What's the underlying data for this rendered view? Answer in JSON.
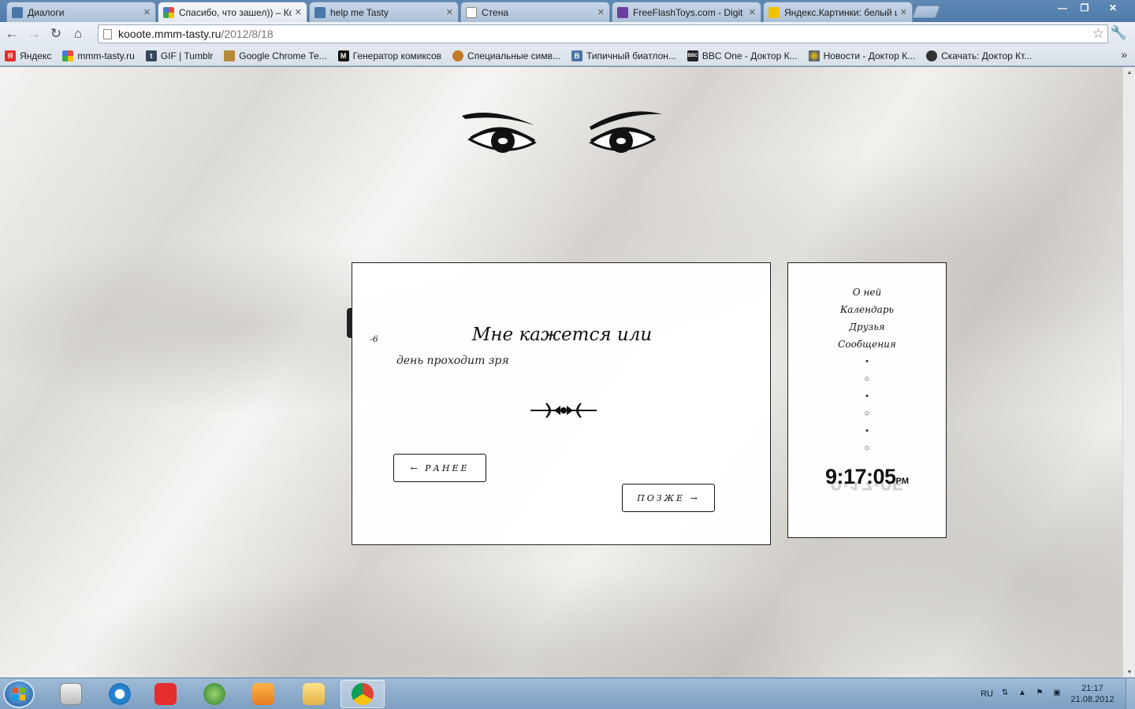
{
  "browser": {
    "tabs": [
      {
        "title": "Диалоги",
        "icon": "vk-icon",
        "color": "#4a76a8"
      },
      {
        "title": "Спасибо, что зашел)) – Кооо",
        "icon": "mmm-tasty-icon",
        "color": "#e84b3c"
      },
      {
        "title": "help me Tasty",
        "icon": "vk-icon",
        "color": "#4a76a8"
      },
      {
        "title": "Стена",
        "icon": "page-icon",
        "color": "#ffffff"
      },
      {
        "title": "FreeFlashToys.com - Digit",
        "icon": "fft-icon",
        "color": "#6b3fa0"
      },
      {
        "title": "Яндекс.Картинки: белый ш",
        "icon": "yandex-images-icon",
        "color": "#f2c200"
      }
    ],
    "url_host": "kooote.mmm-tasty.ru",
    "url_path": "/2012/8/18",
    "bookmarks": [
      {
        "label": "Яндекс",
        "icon": "yandex-icon",
        "color": "#e62d2d"
      },
      {
        "label": "mmm-tasty.ru",
        "icon": "mmm-tasty-icon",
        "color": "#e84b3c"
      },
      {
        "label": "GIF | Tumblr",
        "icon": "tumblr-icon",
        "color": "#35465c"
      },
      {
        "label": "Google Chrome Те...",
        "icon": "chrome-theme-icon",
        "color": "#b58a3a"
      },
      {
        "label": "Генератор комиксов",
        "icon": "comics-icon",
        "color": "#111111"
      },
      {
        "label": "Специальные симв...",
        "icon": "symbols-icon",
        "color": "#c47a28"
      },
      {
        "label": "Типичный биатлон...",
        "icon": "vk-icon",
        "color": "#4a76a8"
      },
      {
        "label": "BBC One - Доктор К...",
        "icon": "bbc-icon",
        "color": "#222222"
      },
      {
        "label": "Новости - Доктор К...",
        "icon": "doctor-icon",
        "color": "#1f3d8a"
      },
      {
        "label": "Скачать: Доктор Кт...",
        "icon": "download-icon",
        "color": "#333333"
      }
    ]
  },
  "post": {
    "date": "-6",
    "title": "Мне кажется или",
    "subtitle": "день проходит зря",
    "earlier_label": "← РАНЕЕ",
    "later_label": "ПОЗЖЕ →"
  },
  "sidebar": {
    "menu": [
      "О ней",
      "Календарь",
      "Друзья",
      "Сообщения"
    ],
    "dots": [
      "•",
      "○",
      "•",
      "○",
      "•",
      "○"
    ],
    "clock_time": "9:17:05",
    "clock_ampm": "PM"
  },
  "taskbar": {
    "lang": "RU",
    "time": "21:17",
    "date": "21.08.2012"
  }
}
